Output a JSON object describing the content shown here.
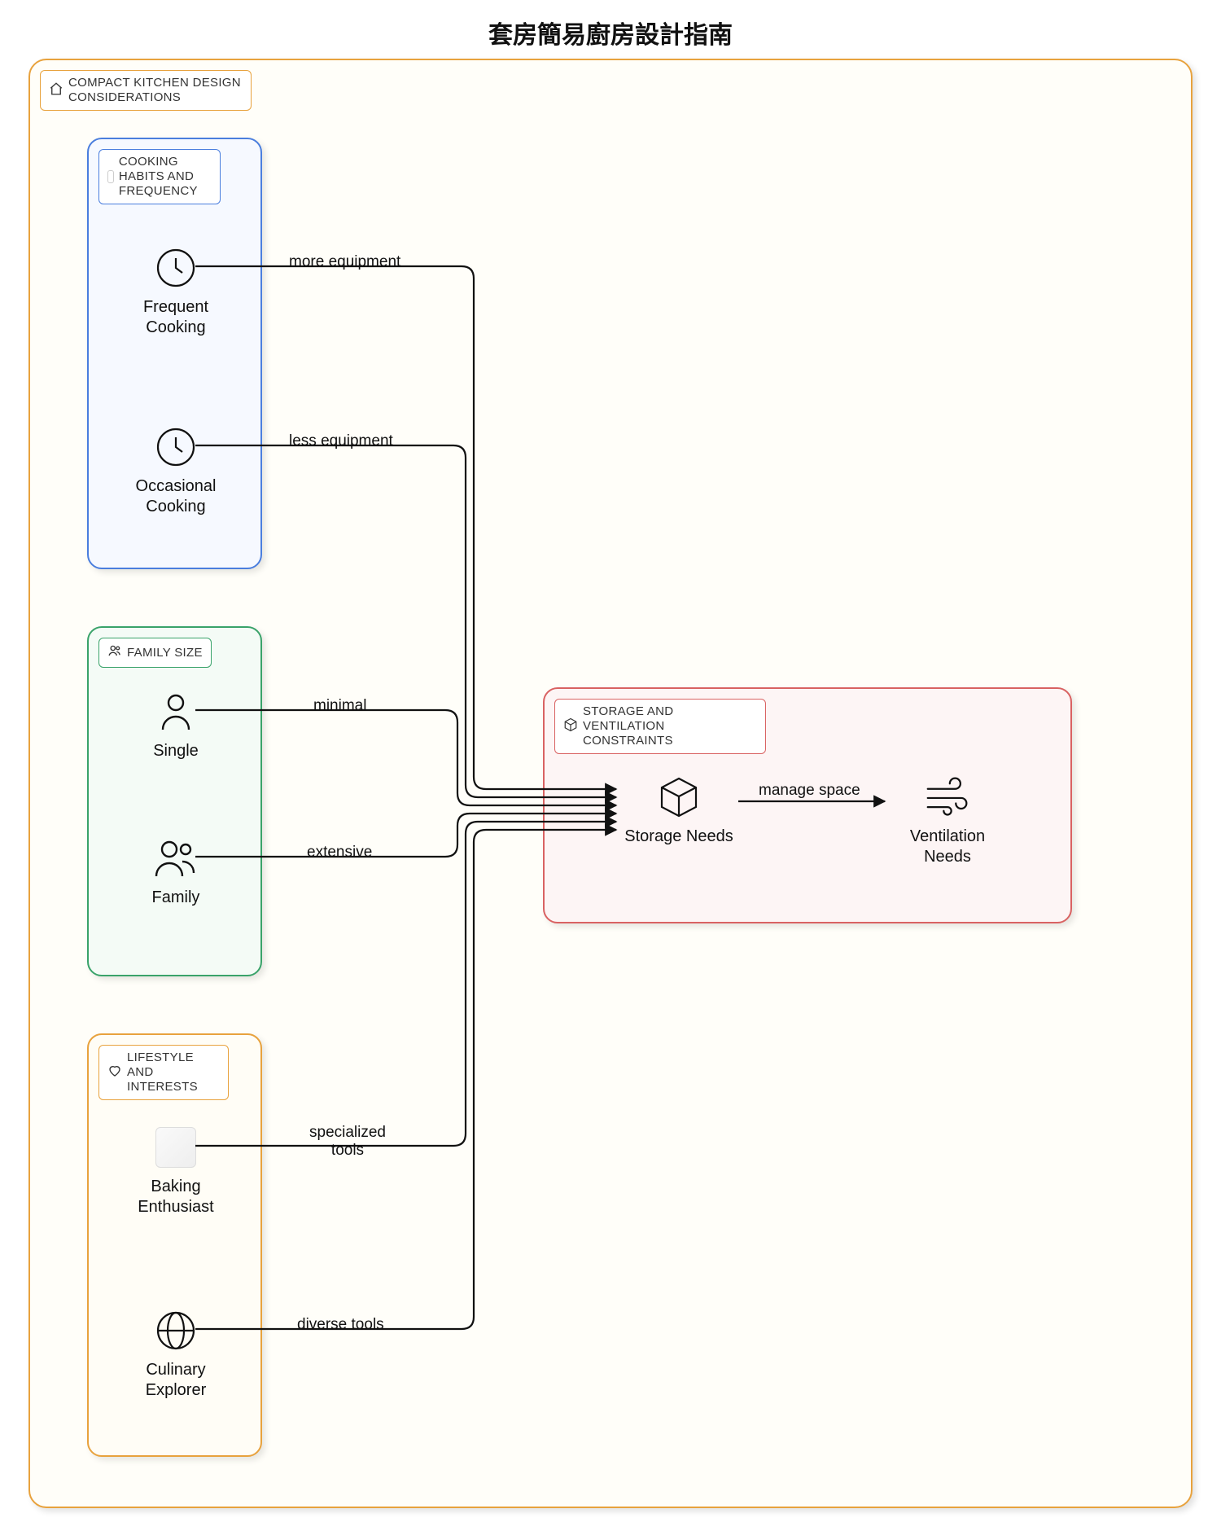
{
  "title": "套房簡易廚房設計指南",
  "outer": {
    "label": "COMPACT KITCHEN DESIGN CONSIDERATIONS"
  },
  "groups": {
    "habits": {
      "label": "COOKING HABITS AND FREQUENCY",
      "nodes": {
        "frequent": "Frequent Cooking",
        "occasional": "Occasional Cooking"
      }
    },
    "family": {
      "label": "FAMILY SIZE",
      "nodes": {
        "single": "Single",
        "family": "Family"
      }
    },
    "lifestyle": {
      "label": "LIFESTYLE AND INTERESTS",
      "nodes": {
        "baking": "Baking Enthusiast",
        "explorer": "Culinary Explorer"
      }
    },
    "constraints": {
      "label": "STORAGE AND VENTILATION CONSTRAINTS",
      "nodes": {
        "storage": "Storage Needs",
        "ventilation": "Ventilation Needs"
      }
    }
  },
  "edges": {
    "more_equipment": "more equipment",
    "less_equipment": "less equipment",
    "minimal": "minimal",
    "extensive": "extensive",
    "specialized_tools": "specialized tools",
    "diverse_tools": "diverse tools",
    "manage_space": "manage space"
  }
}
